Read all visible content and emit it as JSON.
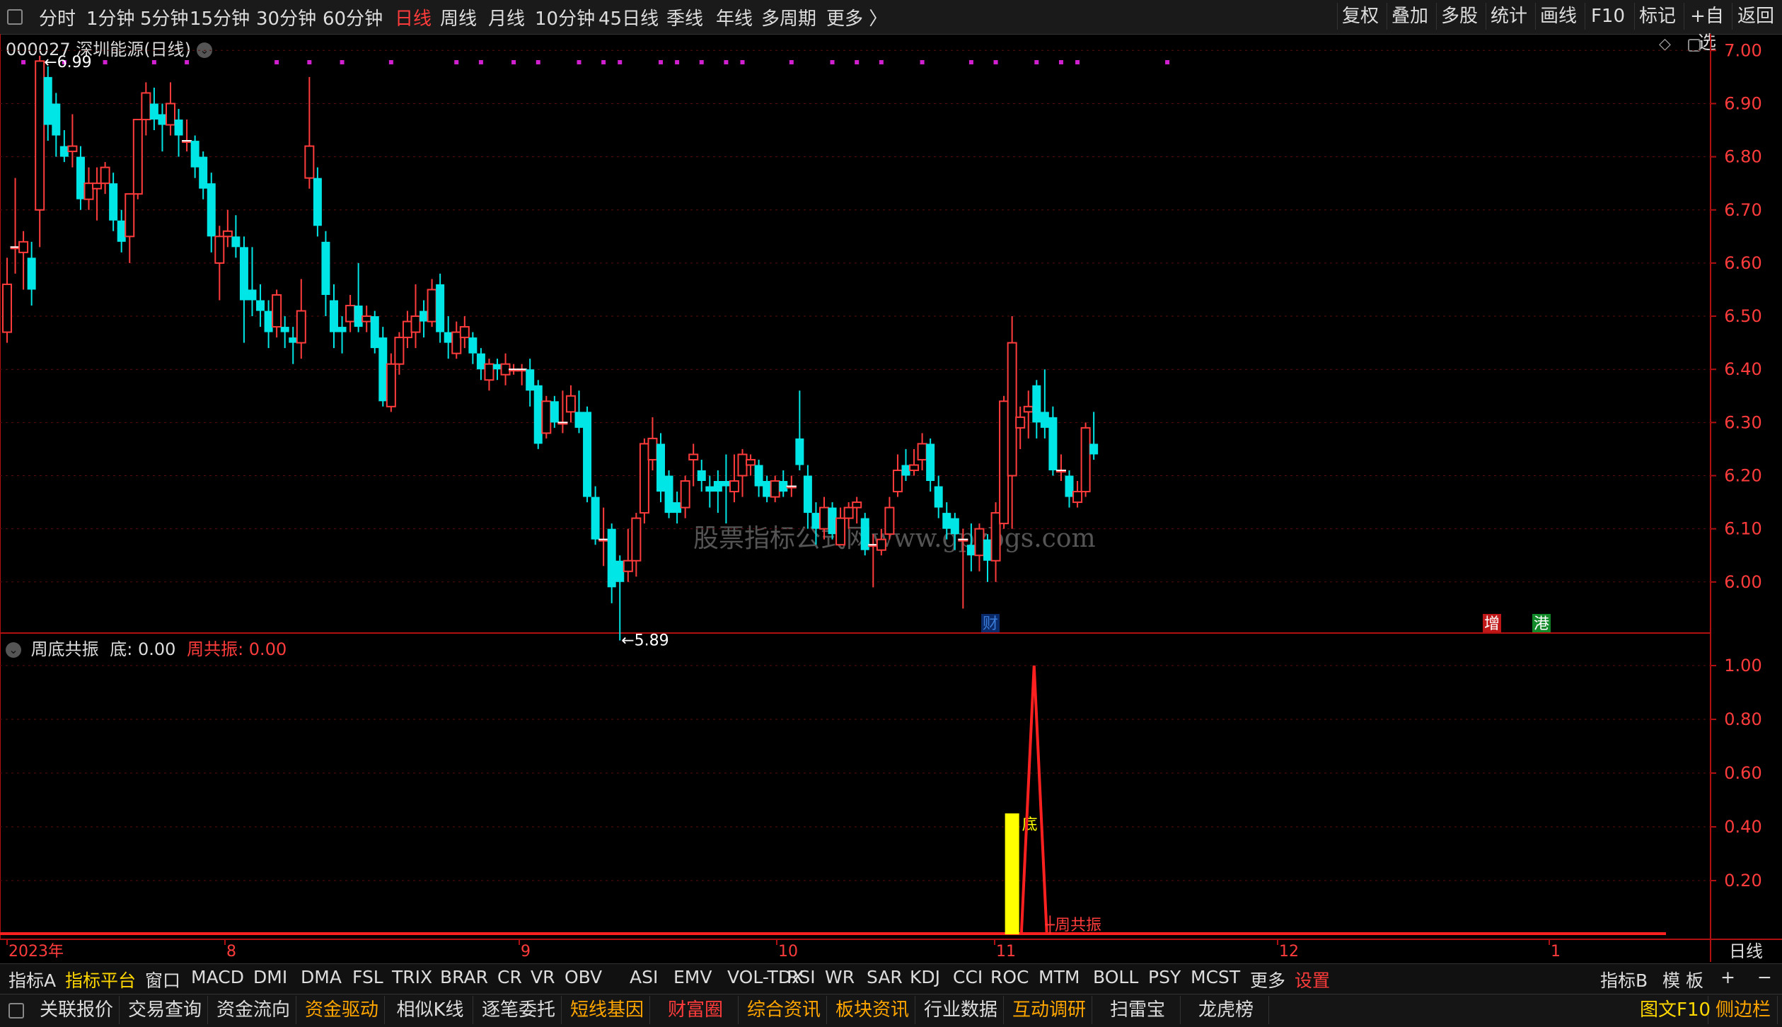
{
  "topbar": {
    "periods": [
      "分时",
      "1分钟",
      "5分钟",
      "15分钟",
      "30分钟",
      "60分钟",
      "日线",
      "周线",
      "月线",
      "10分钟",
      "45日线",
      "季线",
      "年线",
      "多周期",
      "更多 〉"
    ],
    "active_period": "日线",
    "right_buttons": [
      "复权",
      "叠加",
      "多股",
      "统计",
      "画线",
      "F10",
      "标记",
      "+自选",
      "返回"
    ]
  },
  "main_chart": {
    "title": "000027 深圳能源(日线)",
    "high_marker": "6.99",
    "low_marker": "5.89",
    "price_ticks": [
      "7.00",
      "6.90",
      "6.80",
      "6.70",
      "6.60",
      "6.50",
      "6.40",
      "6.30",
      "6.20",
      "6.10",
      "6.00"
    ],
    "event_tags": [
      {
        "text": "财",
        "color": "#3a7bd5",
        "bg": "#0a2a6a"
      },
      {
        "text": "增",
        "color": "#ffffff",
        "bg": "#c01818"
      },
      {
        "text": "港",
        "color": "#ffffff",
        "bg": "#138a2a"
      }
    ],
    "watermark": "股票指标公式网www.gpzbgs.com"
  },
  "sub_chart": {
    "name": "周底共振",
    "di_label": "底: 0.00",
    "zgz_label": "周共振: 0.00",
    "ticks": [
      "1.00",
      "0.80",
      "0.60",
      "0.40",
      "0.20"
    ],
    "di_text": "底",
    "zgz_text": "周共振"
  },
  "time_axis": {
    "labels": [
      "2023年",
      "8",
      "9",
      "10",
      "11",
      "12",
      "1"
    ],
    "period_label": "日线"
  },
  "chart_data": {
    "type": "candlestick",
    "symbol": "000027",
    "title": "000027 深圳能源(日线)",
    "ylim": [
      5.85,
      7.05
    ],
    "candles": [
      {
        "o": 6.47,
        "c": 6.56,
        "h": 6.61,
        "l": 6.45
      },
      {
        "o": 6.63,
        "c": 6.63,
        "h": 6.76,
        "l": 6.58
      },
      {
        "o": 6.62,
        "c": 6.64,
        "h": 6.66,
        "l": 6.55
      },
      {
        "o": 6.61,
        "c": 6.55,
        "h": 6.64,
        "l": 6.52
      },
      {
        "o": 6.7,
        "c": 6.98,
        "h": 6.99,
        "l": 6.63
      },
      {
        "o": 6.95,
        "c": 6.86,
        "h": 6.97,
        "l": 6.83
      },
      {
        "o": 6.9,
        "c": 6.84,
        "h": 6.92,
        "l": 6.8
      },
      {
        "o": 6.82,
        "c": 6.8,
        "h": 6.85,
        "l": 6.79
      },
      {
        "o": 6.81,
        "c": 6.82,
        "h": 6.88,
        "l": 6.78
      },
      {
        "o": 6.8,
        "c": 6.72,
        "h": 6.82,
        "l": 6.7
      },
      {
        "o": 6.72,
        "c": 6.75,
        "h": 6.78,
        "l": 6.7
      },
      {
        "o": 6.74,
        "c": 6.75,
        "h": 6.78,
        "l": 6.68
      },
      {
        "o": 6.75,
        "c": 6.78,
        "h": 6.79,
        "l": 6.73
      },
      {
        "o": 6.75,
        "c": 6.68,
        "h": 6.77,
        "l": 6.66
      },
      {
        "o": 6.68,
        "c": 6.64,
        "h": 6.7,
        "l": 6.62
      },
      {
        "o": 6.65,
        "c": 6.73,
        "h": 6.73,
        "l": 6.6
      },
      {
        "o": 6.73,
        "c": 6.87,
        "h": 6.87,
        "l": 6.72
      },
      {
        "o": 6.87,
        "c": 6.92,
        "h": 6.94,
        "l": 6.84
      },
      {
        "o": 6.9,
        "c": 6.87,
        "h": 6.93,
        "l": 6.85
      },
      {
        "o": 6.88,
        "c": 6.86,
        "h": 6.9,
        "l": 6.81
      },
      {
        "o": 6.86,
        "c": 6.9,
        "h": 6.94,
        "l": 6.84
      },
      {
        "o": 6.87,
        "c": 6.84,
        "h": 6.89,
        "l": 6.8
      },
      {
        "o": 6.83,
        "c": 6.83,
        "h": 6.87,
        "l": 6.81
      },
      {
        "o": 6.83,
        "c": 6.78,
        "h": 6.84,
        "l": 6.76
      },
      {
        "o": 6.8,
        "c": 6.74,
        "h": 6.81,
        "l": 6.72
      },
      {
        "o": 6.75,
        "c": 6.65,
        "h": 6.77,
        "l": 6.62
      },
      {
        "o": 6.6,
        "c": 6.65,
        "h": 6.67,
        "l": 6.53
      },
      {
        "o": 6.65,
        "c": 6.66,
        "h": 6.7,
        "l": 6.63
      },
      {
        "o": 6.65,
        "c": 6.63,
        "h": 6.69,
        "l": 6.61
      },
      {
        "o": 6.63,
        "c": 6.53,
        "h": 6.65,
        "l": 6.45
      },
      {
        "o": 6.55,
        "c": 6.53,
        "h": 6.63,
        "l": 6.5
      },
      {
        "o": 6.53,
        "c": 6.51,
        "h": 6.56,
        "l": 6.48
      },
      {
        "o": 6.51,
        "c": 6.47,
        "h": 6.53,
        "l": 6.44
      },
      {
        "o": 6.48,
        "c": 6.54,
        "h": 6.55,
        "l": 6.46
      },
      {
        "o": 6.48,
        "c": 6.47,
        "h": 6.5,
        "l": 6.44
      },
      {
        "o": 6.46,
        "c": 6.45,
        "h": 6.48,
        "l": 6.41
      },
      {
        "o": 6.45,
        "c": 6.51,
        "h": 6.57,
        "l": 6.42
      },
      {
        "o": 6.76,
        "c": 6.82,
        "h": 6.95,
        "l": 6.74
      },
      {
        "o": 6.76,
        "c": 6.67,
        "h": 6.78,
        "l": 6.65
      },
      {
        "o": 6.64,
        "c": 6.54,
        "h": 6.66,
        "l": 6.5
      },
      {
        "o": 6.53,
        "c": 6.47,
        "h": 6.56,
        "l": 6.44
      },
      {
        "o": 6.48,
        "c": 6.47,
        "h": 6.5,
        "l": 6.43
      },
      {
        "o": 6.49,
        "c": 6.52,
        "h": 6.54,
        "l": 6.47
      },
      {
        "o": 6.52,
        "c": 6.48,
        "h": 6.6,
        "l": 6.47
      },
      {
        "o": 6.49,
        "c": 6.5,
        "h": 6.52,
        "l": 6.47
      },
      {
        "o": 6.5,
        "c": 6.44,
        "h": 6.51,
        "l": 6.43
      },
      {
        "o": 6.46,
        "c": 6.34,
        "h": 6.48,
        "l": 6.33
      },
      {
        "o": 6.33,
        "c": 6.41,
        "h": 6.43,
        "l": 6.32
      },
      {
        "o": 6.41,
        "c": 6.46,
        "h": 6.47,
        "l": 6.39
      },
      {
        "o": 6.46,
        "c": 6.49,
        "h": 6.51,
        "l": 6.44
      },
      {
        "o": 6.47,
        "c": 6.5,
        "h": 6.56,
        "l": 6.44
      },
      {
        "o": 6.51,
        "c": 6.49,
        "h": 6.53,
        "l": 6.46
      },
      {
        "o": 6.49,
        "c": 6.55,
        "h": 6.57,
        "l": 6.48
      },
      {
        "o": 6.56,
        "c": 6.47,
        "h": 6.58,
        "l": 6.45
      },
      {
        "o": 6.47,
        "c": 6.45,
        "h": 6.5,
        "l": 6.42
      },
      {
        "o": 6.43,
        "c": 6.47,
        "h": 6.49,
        "l": 6.42
      },
      {
        "o": 6.46,
        "c": 6.48,
        "h": 6.5,
        "l": 6.44
      },
      {
        "o": 6.46,
        "c": 6.43,
        "h": 6.47,
        "l": 6.41
      },
      {
        "o": 6.43,
        "c": 6.4,
        "h": 6.44,
        "l": 6.38
      },
      {
        "o": 6.38,
        "c": 6.41,
        "h": 6.42,
        "l": 6.36
      },
      {
        "o": 6.41,
        "c": 6.4,
        "h": 6.42,
        "l": 6.38
      },
      {
        "o": 6.39,
        "c": 6.41,
        "h": 6.43,
        "l": 6.37
      },
      {
        "o": 6.4,
        "c": 6.4,
        "h": 6.41,
        "l": 6.39
      },
      {
        "o": 6.4,
        "c": 6.4,
        "h": 6.41,
        "l": 6.37
      },
      {
        "o": 6.4,
        "c": 6.36,
        "h": 6.42,
        "l": 6.33
      },
      {
        "o": 6.37,
        "c": 6.26,
        "h": 6.38,
        "l": 6.25
      },
      {
        "o": 6.28,
        "c": 6.34,
        "h": 6.35,
        "l": 6.27
      },
      {
        "o": 6.34,
        "c": 6.3,
        "h": 6.35,
        "l": 6.29
      },
      {
        "o": 6.3,
        "c": 6.3,
        "h": 6.36,
        "l": 6.28
      },
      {
        "o": 6.32,
        "c": 6.35,
        "h": 6.37,
        "l": 6.3
      },
      {
        "o": 6.32,
        "c": 6.29,
        "h": 6.36,
        "l": 6.28
      },
      {
        "o": 6.32,
        "c": 6.16,
        "h": 6.33,
        "l": 6.15
      },
      {
        "o": 6.16,
        "c": 6.08,
        "h": 6.18,
        "l": 6.07
      },
      {
        "o": 6.08,
        "c": 6.08,
        "h": 6.14,
        "l": 6.03
      },
      {
        "o": 6.1,
        "c": 5.99,
        "h": 6.11,
        "l": 5.96
      },
      {
        "o": 6.04,
        "c": 6.0,
        "h": 6.05,
        "l": 5.89
      },
      {
        "o": 6.02,
        "c": 6.04,
        "h": 6.1,
        "l": 6.0
      },
      {
        "o": 6.04,
        "c": 6.12,
        "h": 6.13,
        "l": 6.01
      },
      {
        "o": 6.13,
        "c": 6.26,
        "h": 6.27,
        "l": 6.11
      },
      {
        "o": 6.23,
        "c": 6.27,
        "h": 6.31,
        "l": 6.21
      },
      {
        "o": 6.26,
        "c": 6.17,
        "h": 6.28,
        "l": 6.15
      },
      {
        "o": 6.2,
        "c": 6.13,
        "h": 6.21,
        "l": 6.12
      },
      {
        "o": 6.15,
        "c": 6.13,
        "h": 6.17,
        "l": 6.11
      },
      {
        "o": 6.14,
        "c": 6.19,
        "h": 6.2,
        "l": 6.12
      },
      {
        "o": 6.23,
        "c": 6.24,
        "h": 6.26,
        "l": 6.18
      },
      {
        "o": 6.21,
        "c": 6.19,
        "h": 6.23,
        "l": 6.17
      },
      {
        "o": 6.18,
        "c": 6.17,
        "h": 6.2,
        "l": 6.14
      },
      {
        "o": 6.19,
        "c": 6.17,
        "h": 6.21,
        "l": 6.13
      },
      {
        "o": 6.19,
        "c": 6.18,
        "h": 6.24,
        "l": 6.11
      },
      {
        "o": 6.17,
        "c": 6.19,
        "h": 6.24,
        "l": 6.15
      },
      {
        "o": 6.2,
        "c": 6.24,
        "h": 6.25,
        "l": 6.16
      },
      {
        "o": 6.22,
        "c": 6.23,
        "h": 6.24,
        "l": 6.2
      },
      {
        "o": 6.22,
        "c": 6.18,
        "h": 6.23,
        "l": 6.16
      },
      {
        "o": 6.19,
        "c": 6.16,
        "h": 6.2,
        "l": 6.15
      },
      {
        "o": 6.16,
        "c": 6.19,
        "h": 6.2,
        "l": 6.15
      },
      {
        "o": 6.19,
        "c": 6.17,
        "h": 6.21,
        "l": 6.16
      },
      {
        "o": 6.18,
        "c": 6.18,
        "h": 6.2,
        "l": 6.16
      },
      {
        "o": 6.27,
        "c": 6.22,
        "h": 6.36,
        "l": 6.21
      },
      {
        "o": 6.2,
        "c": 6.13,
        "h": 6.22,
        "l": 6.1
      },
      {
        "o": 6.13,
        "c": 6.1,
        "h": 6.15,
        "l": 6.07
      },
      {
        "o": 6.1,
        "c": 6.14,
        "h": 6.16,
        "l": 6.08
      },
      {
        "o": 6.14,
        "c": 6.09,
        "h": 6.15,
        "l": 6.08
      },
      {
        "o": 6.07,
        "c": 6.12,
        "h": 6.14,
        "l": 6.07
      },
      {
        "o": 6.12,
        "c": 6.14,
        "h": 6.15,
        "l": 6.1
      },
      {
        "o": 6.14,
        "c": 6.15,
        "h": 6.16,
        "l": 6.11
      },
      {
        "o": 6.12,
        "c": 6.06,
        "h": 6.13,
        "l": 6.05
      },
      {
        "o": 6.07,
        "c": 6.07,
        "h": 6.09,
        "l": 5.99
      },
      {
        "o": 6.06,
        "c": 6.08,
        "h": 6.1,
        "l": 6.05
      },
      {
        "o": 6.09,
        "c": 6.14,
        "h": 6.16,
        "l": 6.08
      },
      {
        "o": 6.17,
        "c": 6.21,
        "h": 6.24,
        "l": 6.16
      },
      {
        "o": 6.22,
        "c": 6.2,
        "h": 6.25,
        "l": 6.19
      },
      {
        "o": 6.21,
        "c": 6.22,
        "h": 6.25,
        "l": 6.2
      },
      {
        "o": 6.23,
        "c": 6.26,
        "h": 6.28,
        "l": 6.21
      },
      {
        "o": 6.26,
        "c": 6.19,
        "h": 6.27,
        "l": 6.17
      },
      {
        "o": 6.18,
        "c": 6.14,
        "h": 6.2,
        "l": 6.12
      },
      {
        "o": 6.13,
        "c": 6.1,
        "h": 6.15,
        "l": 6.08
      },
      {
        "o": 6.12,
        "c": 6.09,
        "h": 6.13,
        "l": 6.06
      },
      {
        "o": 6.08,
        "c": 6.08,
        "h": 6.1,
        "l": 5.95
      },
      {
        "o": 6.07,
        "c": 6.05,
        "h": 6.11,
        "l": 6.02
      },
      {
        "o": 6.05,
        "c": 6.1,
        "h": 6.11,
        "l": 6.02
      },
      {
        "o": 6.08,
        "c": 6.04,
        "h": 6.09,
        "l": 6.0
      },
      {
        "o": 6.04,
        "c": 6.13,
        "h": 6.15,
        "l": 6.0
      },
      {
        "o": 6.11,
        "c": 6.34,
        "h": 6.35,
        "l": 6.1
      },
      {
        "o": 6.2,
        "c": 6.45,
        "h": 6.5,
        "l": 6.1
      },
      {
        "o": 6.29,
        "c": 6.31,
        "h": 6.33,
        "l": 6.25
      },
      {
        "o": 6.32,
        "c": 6.33,
        "h": 6.36,
        "l": 6.27
      },
      {
        "o": 6.37,
        "c": 6.3,
        "h": 6.38,
        "l": 6.27
      },
      {
        "o": 6.32,
        "c": 6.29,
        "h": 6.4,
        "l": 6.27
      },
      {
        "o": 6.31,
        "c": 6.21,
        "h": 6.33,
        "l": 6.2
      },
      {
        "o": 6.21,
        "c": 6.21,
        "h": 6.24,
        "l": 6.19
      },
      {
        "o": 6.2,
        "c": 6.16,
        "h": 6.21,
        "l": 6.14
      },
      {
        "o": 6.15,
        "c": 6.17,
        "h": 6.19,
        "l": 6.14
      },
      {
        "o": 6.17,
        "c": 6.29,
        "h": 6.3,
        "l": 6.16
      },
      {
        "o": 6.26,
        "c": 6.24,
        "h": 6.32,
        "l": 6.23
      }
    ],
    "indicator": {
      "name": "周底共振",
      "series": [
        {
          "name": "底",
          "type": "bar",
          "values": [
            0.45
          ],
          "at_candle": 123
        },
        {
          "name": "周共振",
          "type": "line",
          "peak": 1.0,
          "peak_at_candle": 125
        }
      ],
      "ylim": [
        0,
        1.05
      ]
    }
  },
  "indicator_tabs": {
    "items": [
      "指标A",
      "指标平台",
      "窗口",
      "MACD",
      "DMI",
      "DMA",
      "FSL",
      "TRIX",
      "BRAR",
      "CR",
      "VR",
      "OBV",
      "ASI",
      "EMV",
      "VOL-TDX",
      "RSI",
      "WR",
      "SAR",
      "KDJ",
      "CCI",
      "ROC",
      "MTM",
      "BOLL",
      "PSY",
      "MCST",
      "更多",
      "设置"
    ],
    "highlight": "指标平台",
    "red": "设置",
    "right_items": [
      "指标B",
      "模 板",
      "+",
      "−"
    ]
  },
  "bottom_bar": {
    "items": [
      {
        "label": "关联报价",
        "color": "#ddd"
      },
      {
        "label": "交易查询",
        "color": "#ddd"
      },
      {
        "label": "资金流向",
        "color": "#ddd"
      },
      {
        "label": "资金驱动",
        "color": "#ffa500"
      },
      {
        "label": "相似K线",
        "color": "#ddd"
      },
      {
        "label": "逐笔委托",
        "color": "#ddd"
      },
      {
        "label": "短线基因",
        "color": "#ffa500"
      },
      {
        "label": "财富圈",
        "color": "#ff3c3c"
      },
      {
        "label": "综合资讯",
        "color": "#ffa500"
      },
      {
        "label": "板块资讯",
        "color": "#ffa500"
      },
      {
        "label": "行业数据",
        "color": "#ddd"
      },
      {
        "label": "互动调研",
        "color": "#ffa500"
      },
      {
        "label": "扫雷宝",
        "color": "#ddd"
      },
      {
        "label": "龙虎榜",
        "color": "#ddd"
      }
    ],
    "right_items": [
      {
        "label": "图文F10",
        "color": "#ffd700"
      },
      {
        "label": "侧边栏",
        "color": "#ffa500"
      }
    ]
  },
  "colors": {
    "up": "#ff3c3c",
    "down": "#00e5e5",
    "axis": "#b01010",
    "marker_dots": "#d020d0",
    "indicator_bar": "#ffff00",
    "indicator_line": "#ff2020"
  }
}
